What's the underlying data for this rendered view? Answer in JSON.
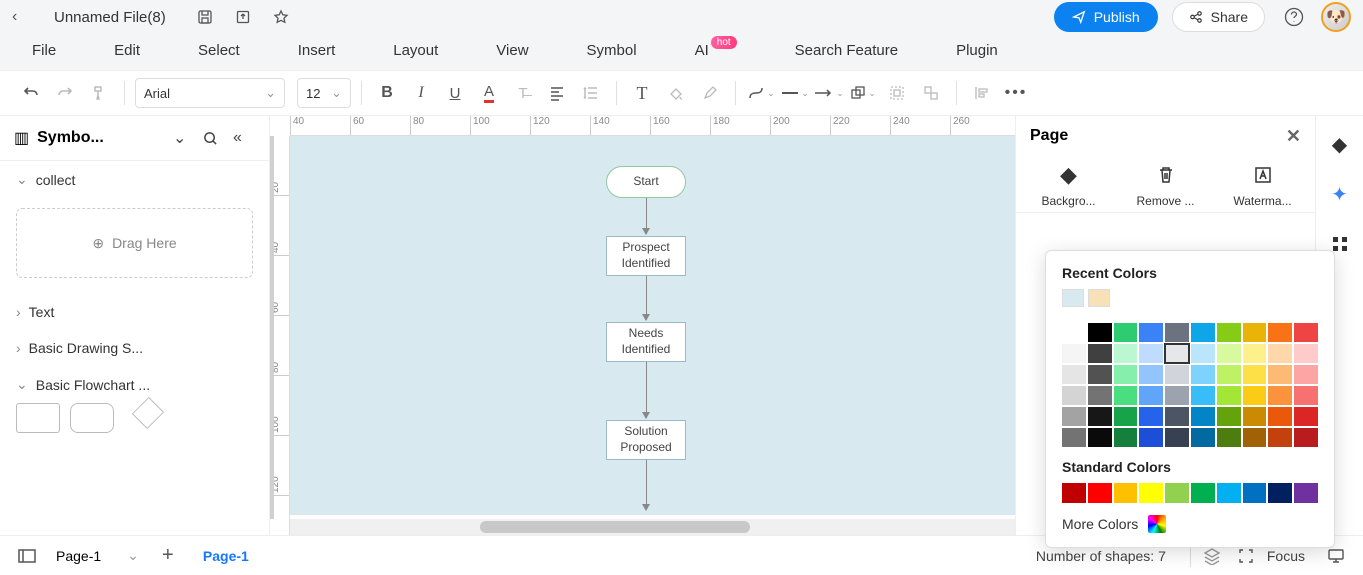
{
  "title": {
    "filename": "Unnamed File(8)"
  },
  "menu": {
    "items": [
      "File",
      "Edit",
      "Select",
      "Insert",
      "Layout",
      "View",
      "Symbol",
      "AI",
      "Search Feature",
      "Plugin"
    ],
    "hot_on": "AI"
  },
  "header_buttons": {
    "publish": "Publish",
    "share": "Share",
    "help": "?"
  },
  "toolbar": {
    "font": "Arial",
    "size": "12"
  },
  "left_panel": {
    "title": "Symbo...",
    "sections": {
      "collect": {
        "label": "collect",
        "drag_here": "Drag Here",
        "expanded": true
      },
      "text": {
        "label": "Text",
        "expanded": false
      },
      "basic_drawing": {
        "label": "Basic Drawing S...",
        "expanded": false
      },
      "basic_flowchart": {
        "label": "Basic Flowchart ...",
        "expanded": true
      }
    }
  },
  "canvas": {
    "ruler_h": [
      "40",
      "60",
      "80",
      "100",
      "120",
      "140",
      "160",
      "180",
      "200",
      "220",
      "240",
      "260"
    ],
    "ruler_v": [
      "20",
      "40",
      "60",
      "80",
      "100",
      "120"
    ],
    "nodes": {
      "start": "Start",
      "prospect": "Prospect Identified",
      "needs": "Needs Identified",
      "solution": "Solution Proposed"
    }
  },
  "right_panel": {
    "title": "Page",
    "actions": {
      "background": "Backgro...",
      "remove": "Remove ...",
      "watermark": "Waterma..."
    }
  },
  "color_popup": {
    "recent_title": "Recent Colors",
    "recent": [
      "#d8e9f0",
      "#f7e2b8"
    ],
    "palette": [
      [
        "#ffffff",
        "#000000",
        "#2ecc71",
        "#3b82f6",
        "#6b7280",
        "#0ea5e9",
        "#84cc16",
        "#eab308",
        "#f97316",
        "#ef4444"
      ],
      [
        "#f5f5f5",
        "#404040",
        "#bbf7d0",
        "#bfdbfe",
        "#e5e7eb",
        "#bae6fd",
        "#d9f99d",
        "#fef08a",
        "#fed7aa",
        "#fecaca"
      ],
      [
        "#e5e5e5",
        "#525252",
        "#86efac",
        "#93c5fd",
        "#d1d5db",
        "#7dd3fc",
        "#bef264",
        "#fde047",
        "#fdba74",
        "#fca5a5"
      ],
      [
        "#d4d4d4",
        "#737373",
        "#4ade80",
        "#60a5fa",
        "#9ca3af",
        "#38bdf8",
        "#a3e635",
        "#facc15",
        "#fb923c",
        "#f87171"
      ],
      [
        "#a3a3a3",
        "#171717",
        "#16a34a",
        "#2563eb",
        "#4b5563",
        "#0284c7",
        "#65a30d",
        "#ca8a04",
        "#ea580c",
        "#dc2626"
      ],
      [
        "#737373",
        "#0a0a0a",
        "#15803d",
        "#1d4ed8",
        "#374151",
        "#0369a1",
        "#4d7c0f",
        "#a16207",
        "#c2410c",
        "#b91c1c"
      ]
    ],
    "selected_palette_index": [
      1,
      4
    ],
    "standard_title": "Standard Colors",
    "standard": [
      "#c00000",
      "#ff0000",
      "#ffc000",
      "#ffff00",
      "#92d050",
      "#00b050",
      "#00b0f0",
      "#0070c0",
      "#002060",
      "#7030a0"
    ],
    "more_title": "More Colors"
  },
  "bottom": {
    "page_selector": "Page-1",
    "tab_active": "Page-1",
    "shape_count": "Number of shapes: 7",
    "focus": "Focus"
  }
}
